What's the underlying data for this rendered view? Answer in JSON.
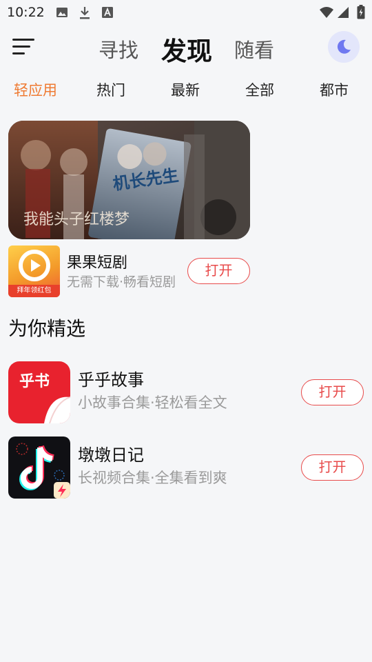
{
  "status_bar": {
    "time": "10:22",
    "left_icons": [
      "image-icon",
      "download-icon",
      "font-a-icon"
    ],
    "right_icons": [
      "wifi-icon",
      "cell-signal-icon",
      "battery-charging-icon"
    ]
  },
  "header": {
    "menu_icon": "hamburger-menu-icon",
    "tabs": [
      {
        "label": "寻找",
        "active": false
      },
      {
        "label": "发现",
        "active": true
      },
      {
        "label": "随看",
        "active": false
      }
    ],
    "night_mode_icon": "moon-icon",
    "night_mode_color": "#6f78f0"
  },
  "categories": [
    {
      "label": "轻应用",
      "active": true
    },
    {
      "label": "热门",
      "active": false
    },
    {
      "label": "最新",
      "active": false
    },
    {
      "label": "全部",
      "active": false
    },
    {
      "label": "都市",
      "active": false
    }
  ],
  "accent_color": "#ef7a32",
  "button_color": "#e84a4a",
  "featured": {
    "banner": {
      "poster_text_1": "我能头子红楼梦",
      "poster_text_2": "机长先生"
    },
    "app": {
      "name": "果果短剧",
      "desc": "无需下载·畅看短剧",
      "button": "打开",
      "icon_badge": "拜年领红包",
      "icon": "play-icon"
    }
  },
  "section_title": "为你精选",
  "apps": [
    {
      "name": "乎乎故事",
      "desc": "小故事合集·轻松看全文",
      "button": "打开",
      "icon_text": "乎书",
      "icon": "book-app-icon"
    },
    {
      "name": "墩墩日记",
      "desc": "长视频合集·全集看到爽",
      "button": "打开",
      "icon": "tiktok-note-icon"
    }
  ]
}
